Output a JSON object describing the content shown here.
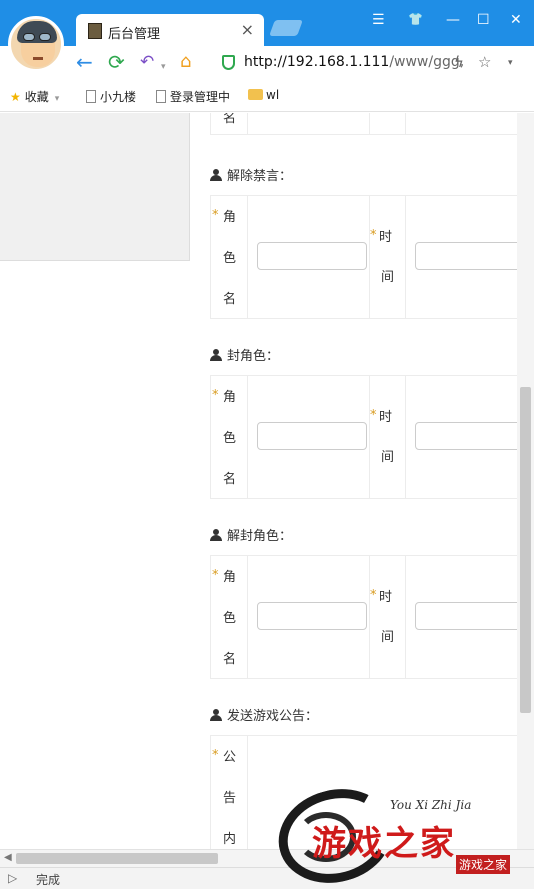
{
  "browser": {
    "tab_title": "后台管理",
    "tab_close": "×",
    "url_host": "http://192.168.1.111",
    "url_path": "/www/ggg,",
    "window_controls": [
      "☰",
      "👕",
      "—",
      "☐",
      "✕"
    ]
  },
  "bookmarks": [
    {
      "label": "收藏",
      "icon": "star-icon"
    },
    {
      "label": "小九楼",
      "icon": "page-icon"
    },
    {
      "label": "登录管理中",
      "icon": "page-icon"
    },
    {
      "label": "wl",
      "icon": "folder-icon"
    }
  ],
  "page": {
    "top_partial_label": "名",
    "sections": [
      {
        "title": "解除禁言：",
        "field1_label": [
          "角",
          "色",
          "名"
        ],
        "field2_label": [
          "时",
          "间"
        ]
      },
      {
        "title": "封角色：",
        "field1_label": [
          "角",
          "色",
          "名"
        ],
        "field2_label": [
          "时",
          "间"
        ]
      },
      {
        "title": "解封角色：",
        "field1_label": [
          "角",
          "色",
          "名"
        ],
        "field2_label": [
          "时",
          "间"
        ]
      },
      {
        "title": "发送游戏公告：",
        "field1_label": [
          "公",
          "告",
          "内"
        ]
      }
    ],
    "required_mark": "*"
  },
  "status": {
    "text": "完成"
  },
  "watermark": {
    "main": "游戏之家",
    "pinyin": "You Xi Zhi Jia",
    "badge": "游戏之家"
  }
}
